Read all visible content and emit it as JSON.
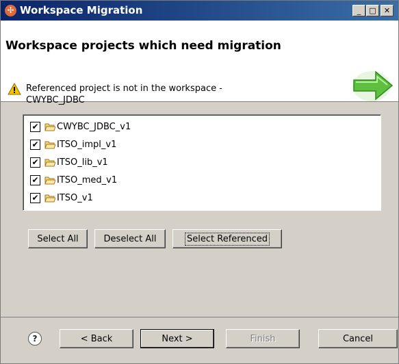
{
  "window": {
    "title": "Workspace Migration",
    "minimize": "_",
    "maximize": "□",
    "close": "✕"
  },
  "header": {
    "title": "Workspace projects which need migration",
    "message_line1": "Referenced project is not in the workspace -",
    "message_line2": "CWYBC_JDBC"
  },
  "projects": [
    {
      "name": "CWYBC_JDBC_v1",
      "checked": true
    },
    {
      "name": "ITSO_impl_v1",
      "checked": true
    },
    {
      "name": "ITSO_lib_v1",
      "checked": true
    },
    {
      "name": "ITSO_med_v1",
      "checked": true
    },
    {
      "name": "ITSO_v1",
      "checked": true
    }
  ],
  "selection_buttons": {
    "select_all": "Select All",
    "deselect_all": "Deselect All",
    "select_referenced": "Select Referenced"
  },
  "footer": {
    "help": "?",
    "back_label": "< Back",
    "next_label": "Next >",
    "finish_label": "Finish",
    "cancel_label": "Cancel"
  },
  "colors": {
    "titlebar_start": "#0a246a",
    "titlebar_end": "#3a6ea5",
    "dialog_bg": "#d4d0c8",
    "warning_icon": "#f5c400",
    "arrow_green": "#5fbf3f"
  },
  "icons": {
    "window": "eclipse-workspace-icon",
    "warning": "warning-icon",
    "wizard_banner": "green-arrow-icon",
    "project": "open-folder-icon",
    "help": "help-icon"
  }
}
